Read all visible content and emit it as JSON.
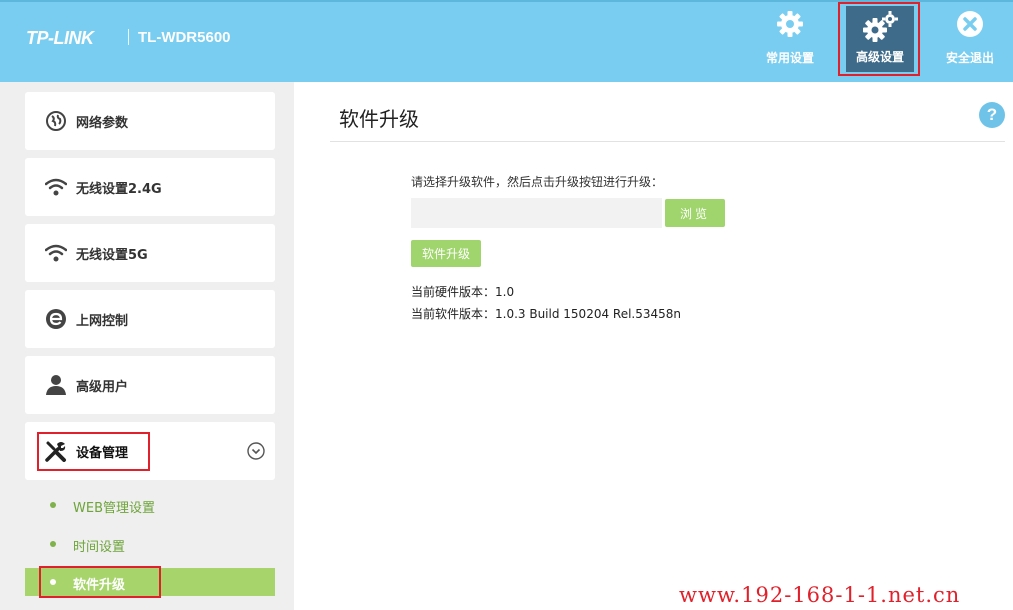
{
  "header": {
    "brand": "TP-LINK",
    "model": "TL-WDR5600",
    "nav": {
      "common": "常用设置",
      "advanced": "高级设置",
      "logout": "安全退出"
    }
  },
  "sidebar": {
    "items": [
      {
        "label": "网络参数",
        "icon": "globe-icon"
      },
      {
        "label": "无线设置2.4G",
        "icon": "wifi-icon"
      },
      {
        "label": "无线设置5G",
        "icon": "wifi-icon"
      },
      {
        "label": "上网控制",
        "icon": "internet-e-icon"
      },
      {
        "label": "高级用户",
        "icon": "user-icon"
      },
      {
        "label": "设备管理",
        "icon": "tools-icon",
        "expanded": true
      }
    ],
    "subitems": [
      {
        "label": "WEB管理设置",
        "active": false
      },
      {
        "label": "时间设置",
        "active": false
      },
      {
        "label": "软件升级",
        "active": true
      }
    ]
  },
  "main": {
    "title": "软件升级",
    "instruction": "请选择升级软件，然后点击升级按钮进行升级：",
    "file_value": "",
    "browse_label": "浏览",
    "upgrade_label": "软件升级",
    "hardware_version": "当前硬件版本：1.0",
    "software_version": "当前软件版本：1.0.3 Build 150204 Rel.53458n"
  },
  "watermark": "www.192-168-1-1.net.cn",
  "colors": {
    "header_bg": "#79cdf0",
    "active_nav_bg": "#3f6b8a",
    "accent_green": "#9fd56c",
    "highlight_red": "#e0202a",
    "sidebar_bg": "#efefef"
  }
}
